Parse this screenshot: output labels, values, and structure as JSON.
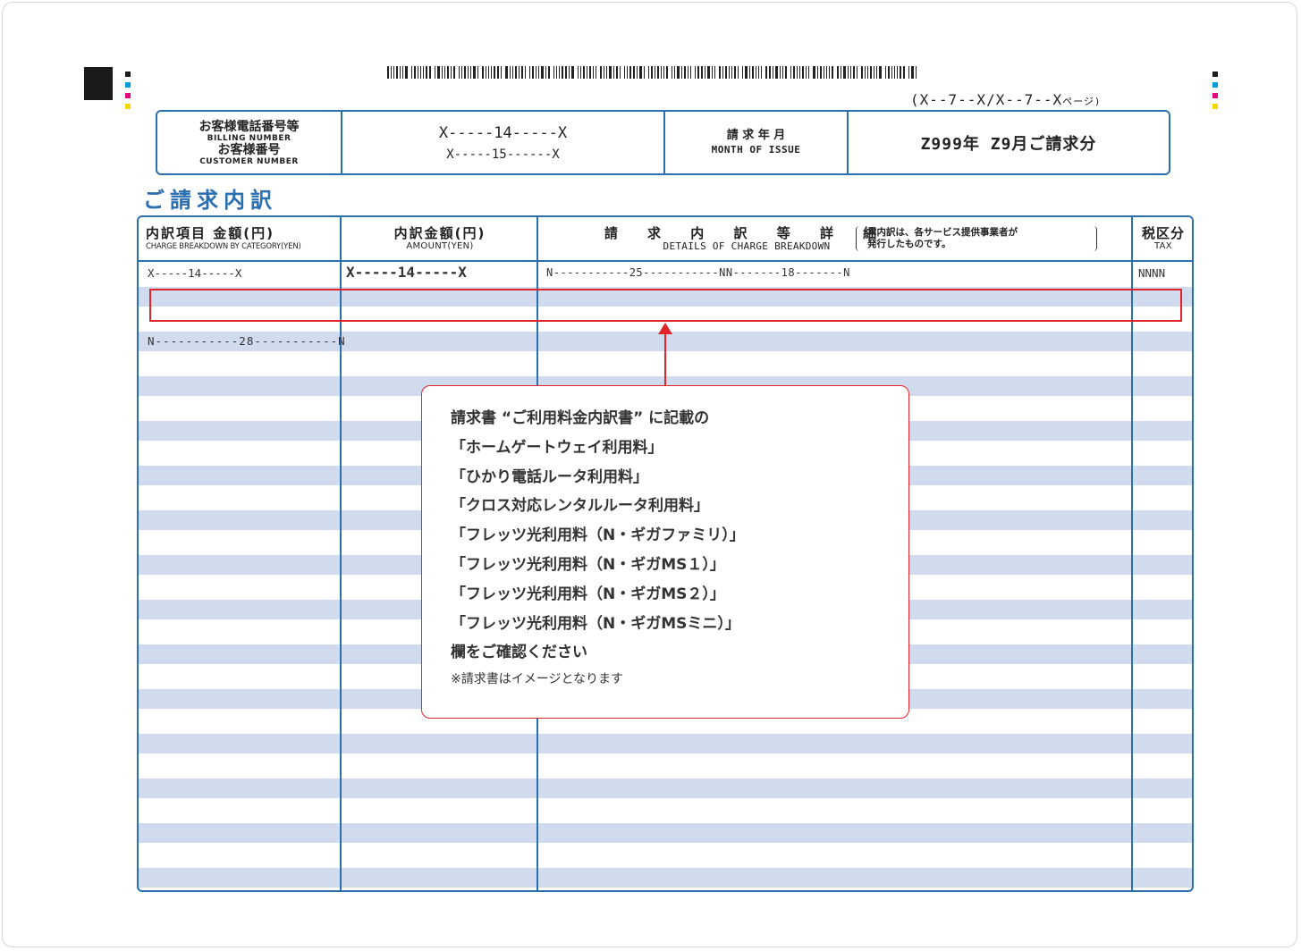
{
  "page_indicator": {
    "text": "(X--7--X/X--7--X",
    "suffix": "ページ)"
  },
  "header": {
    "billing_label_jp": "お客様電話番号等",
    "billing_label_en": "BILLING NUMBER",
    "customer_label_jp": "お客様番号",
    "customer_label_en": "CUSTOMER NUMBER",
    "billing_value": "X-----14-----X",
    "customer_value": "X-----15------X",
    "month_label_jp": "請 求 年 月",
    "month_label_en": "MONTH OF ISSUE",
    "month_value": "Z999年 Z9月ご請求分"
  },
  "section_title": "ご請求内訳",
  "table": {
    "col1_jp": "内訳項目 金額(円)",
    "col1_en": "CHARGE BREAKDOWN BY CATEGORY(YEN)",
    "col2_jp": "内訳金額(円)",
    "col2_en": "AMOUNT(YEN)",
    "col3_jp": "請 求 内 訳 等 詳 細",
    "col3_en": "DETAILS OF CHARGE BREAKDOWN",
    "col3_note_1": "本内訳は、各サービス提供事業者が",
    "col3_note_2": "発行したものです。",
    "col4_jp": "税区分",
    "col4_en": "TAX",
    "row1_c1": "X-----14-----X",
    "row1_c2": "X-----14-----X",
    "row1_c3a": "N-----------25-----------NN-------18-------N",
    "row1_c4": "NNNN",
    "row2_c1": "N-----------28-----------N"
  },
  "callout": {
    "lines": [
      "請求書 “ご利用料金内訳書” に記載の",
      "「ホームゲートウェイ利用料」",
      "「ひかり電話ルータ利用料」",
      "「クロス対応レンタルルータ利用料」",
      "「フレッツ光利用料（N・ギガファミリ）」",
      "「フレッツ光利用料（N・ギガMS１）」",
      "「フレッツ光利用料（N・ギガMS２）」",
      "「フレッツ光利用料（N・ギガMSミニ）」",
      "欄をご確認ください"
    ],
    "note": "※請求書はイメージとなります"
  },
  "colors": {
    "accent_blue": "#2a6fb0",
    "stripe": "#d1dbee",
    "highlight_red": "#e0242a"
  }
}
